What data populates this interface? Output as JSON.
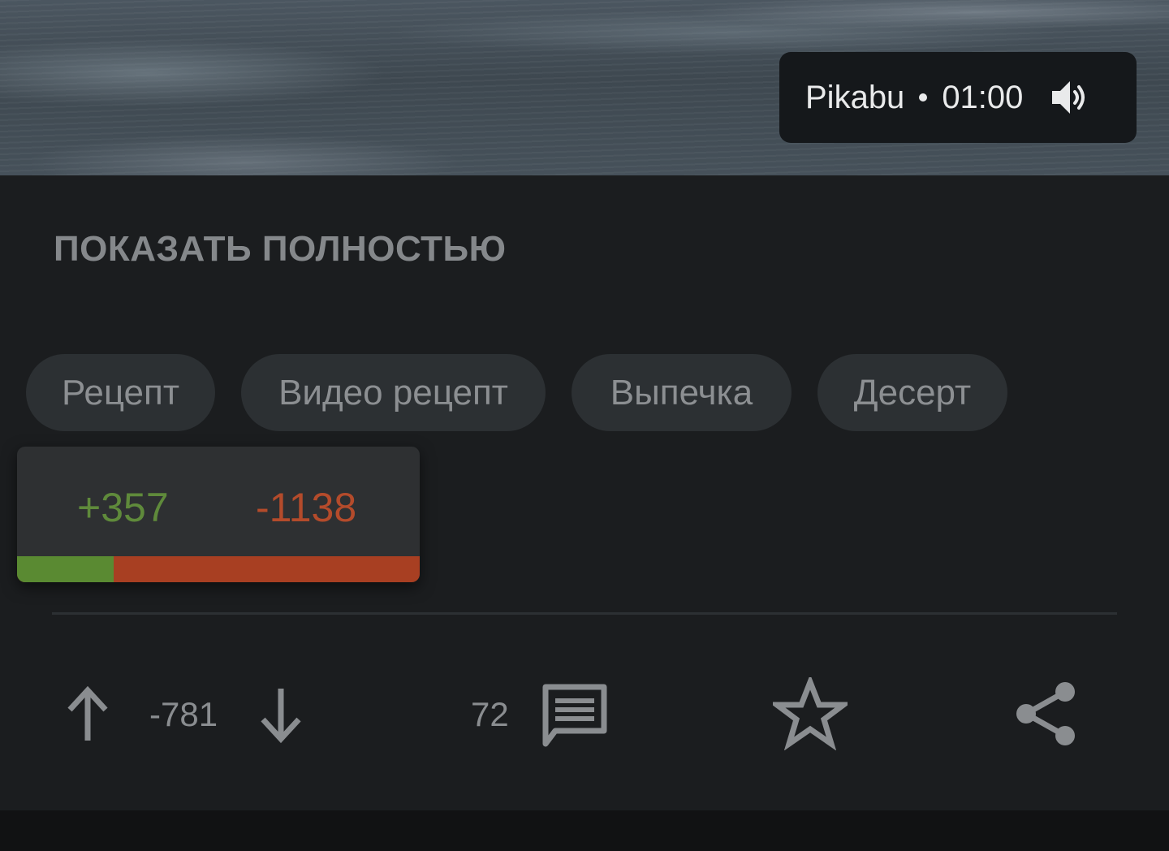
{
  "video": {
    "source": "Pikabu",
    "duration": "01:00",
    "sound_icon": "volume-icon"
  },
  "post": {
    "show_full_label": "ПОКАЗАТЬ ПОЛНОСТЬЮ",
    "tags": [
      "Рецепт",
      "Видео рецепт",
      "Выпечка",
      "Десерт"
    ]
  },
  "rating_popup": {
    "plus": "+357",
    "minus": "-1138",
    "plus_share": 0.239,
    "colors": {
      "plus": "#5a8a32",
      "minus": "#a83f22"
    }
  },
  "actions": {
    "upvote_icon": "arrow-up-icon",
    "score": "-781",
    "downvote_icon": "arrow-down-icon",
    "comments_count": "72",
    "comments_icon": "comment-icon",
    "save_icon": "star-icon",
    "share_icon": "share-icon"
  }
}
